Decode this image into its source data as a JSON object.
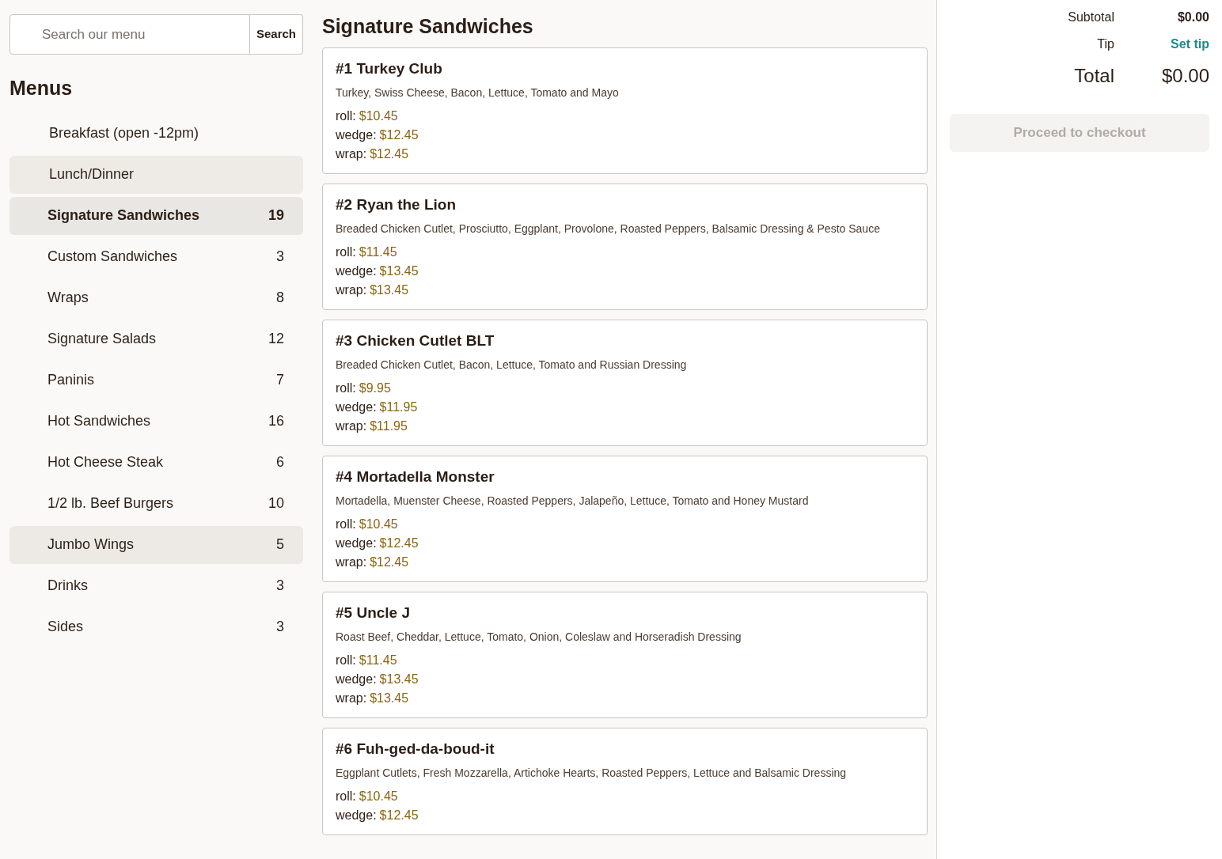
{
  "search": {
    "placeholder": "Search our menu",
    "button": "Search"
  },
  "menus": {
    "title": "Menus",
    "items": [
      {
        "label": "Breakfast (open -12pm)",
        "selected": false
      },
      {
        "label": "Lunch/Dinner",
        "selected": true
      }
    ],
    "categories": [
      {
        "label": "Signature Sandwiches",
        "count": "19",
        "selected": true,
        "hovered": false
      },
      {
        "label": "Custom Sandwiches",
        "count": "3",
        "selected": false,
        "hovered": false
      },
      {
        "label": "Wraps",
        "count": "8",
        "selected": false,
        "hovered": false
      },
      {
        "label": "Signature Salads",
        "count": "12",
        "selected": false,
        "hovered": false
      },
      {
        "label": "Paninis",
        "count": "7",
        "selected": false,
        "hovered": false
      },
      {
        "label": "Hot Sandwiches",
        "count": "16",
        "selected": false,
        "hovered": false
      },
      {
        "label": "Hot Cheese Steak",
        "count": "6",
        "selected": false,
        "hovered": false
      },
      {
        "label": "1/2 lb. Beef Burgers",
        "count": "10",
        "selected": false,
        "hovered": false
      },
      {
        "label": "Jumbo Wings",
        "count": "5",
        "selected": false,
        "hovered": true
      },
      {
        "label": "Drinks",
        "count": "3",
        "selected": false,
        "hovered": false
      },
      {
        "label": "Sides",
        "count": "3",
        "selected": false,
        "hovered": false
      }
    ]
  },
  "section": {
    "title": "Signature Sandwiches",
    "items": [
      {
        "name": "#1 Turkey Club",
        "description": "Turkey, Swiss Cheese, Bacon, Lettuce, Tomato and Mayo",
        "prices": [
          {
            "label": "roll:",
            "price": "$10.45"
          },
          {
            "label": "wedge:",
            "price": "$12.45"
          },
          {
            "label": "wrap:",
            "price": "$12.45"
          }
        ]
      },
      {
        "name": "#2 Ryan the Lion",
        "description": "Breaded Chicken Cutlet, Prosciutto, Eggplant, Provolone, Roasted Peppers, Balsamic Dressing & Pesto Sauce",
        "prices": [
          {
            "label": "roll:",
            "price": "$11.45"
          },
          {
            "label": "wedge:",
            "price": "$13.45"
          },
          {
            "label": "wrap:",
            "price": "$13.45"
          }
        ]
      },
      {
        "name": "#3 Chicken Cutlet BLT",
        "description": "Breaded Chicken Cutlet, Bacon, Lettuce, Tomato and Russian Dressing",
        "prices": [
          {
            "label": "roll:",
            "price": "$9.95"
          },
          {
            "label": "wedge:",
            "price": "$11.95"
          },
          {
            "label": "wrap:",
            "price": "$11.95"
          }
        ]
      },
      {
        "name": "#4 Mortadella Monster",
        "description": "Mortadella, Muenster Cheese, Roasted Peppers, Jalapeño, Lettuce, Tomato and Honey Mustard",
        "prices": [
          {
            "label": "roll:",
            "price": "$10.45"
          },
          {
            "label": "wedge:",
            "price": "$12.45"
          },
          {
            "label": "wrap:",
            "price": "$12.45"
          }
        ]
      },
      {
        "name": "#5 Uncle J",
        "description": "Roast Beef, Cheddar, Lettuce, Tomato, Onion, Coleslaw and Horseradish Dressing",
        "prices": [
          {
            "label": "roll:",
            "price": "$11.45"
          },
          {
            "label": "wedge:",
            "price": "$13.45"
          },
          {
            "label": "wrap:",
            "price": "$13.45"
          }
        ]
      },
      {
        "name": "#6 Fuh-ged-da-boud-it",
        "description": "Eggplant Cutlets, Fresh Mozzarella, Artichoke Hearts, Roasted Peppers, Lettuce and Balsamic Dressing",
        "prices": [
          {
            "label": "roll:",
            "price": "$10.45"
          },
          {
            "label": "wedge:",
            "price": "$12.45"
          }
        ]
      }
    ]
  },
  "cart": {
    "subtotal_label": "Subtotal",
    "subtotal": "$0.00",
    "tip_label": "Tip",
    "tip_link": "Set tip",
    "total_label": "Total",
    "total": "$0.00",
    "checkout": {
      "label": "Proceed to checkout",
      "disabled": true
    }
  }
}
